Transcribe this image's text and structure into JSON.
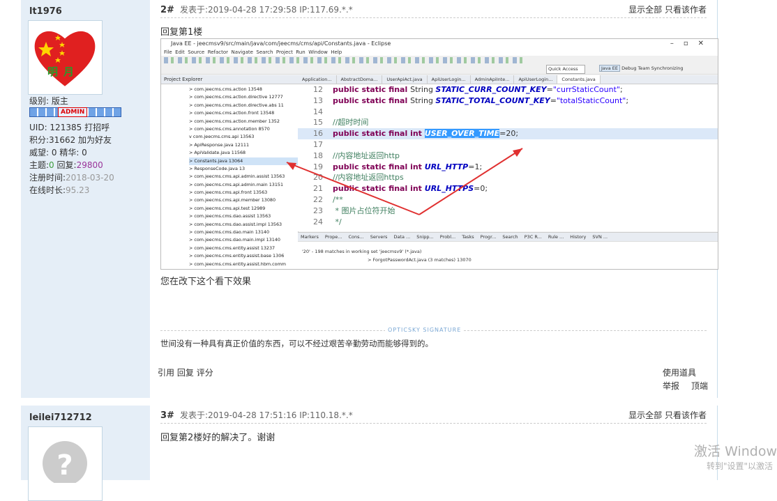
{
  "post1": {
    "username": "lt1976",
    "avatar_text": "明月",
    "level": "级别: 版主",
    "admin_badge": "ADMIN",
    "uid": "UID: 121385",
    "greet": "打招呼",
    "points": "积分:31662",
    "add_friend": "加为好友",
    "prestige": "威望: 0",
    "essence": "精华: 0",
    "topics_label": "主题:",
    "topics": "0",
    "replies_label": "回复:",
    "replies": "29800",
    "reg_label": "注册时间:",
    "reg_date": "2018-03-20",
    "online_label": "在线时长:",
    "online": "95.23",
    "floor": "2#",
    "time": "发表于:2019-04-28 17:29:58  IP:117.69.*.*",
    "show_all": "显示全部",
    "only_author": "只看该作者",
    "reply_to": "回复第1楼",
    "body": "您在改下这个看下效果",
    "sig_label": "OPTICSKY SIGNATURE",
    "signature": "世间没有一种具有真正价值的东西，可以不经过艰苦辛勤劳动而能够得到的。",
    "actions": [
      "引用",
      "回复",
      "评分"
    ],
    "use_tool": "使用道具",
    "report": "举报",
    "top": "顶端"
  },
  "post2": {
    "username": "leilei712712",
    "floor": "3#",
    "time": "发表于:2019-04-28 17:51:16  IP:110.18.*.*",
    "show_all": "显示全部",
    "only_author": "只看该作者",
    "body": "回复第2楼好的解决了。谢谢"
  },
  "eclipse": {
    "title": "Java EE - jeecmsv9/src/main/java/com/jeecms/cms/api/Constants.java - Eclipse",
    "menu": [
      "File",
      "Edit",
      "Source",
      "Refactor",
      "Navigate",
      "Search",
      "Project",
      "Run",
      "Window",
      "Help"
    ],
    "quick_access": "Quick Access",
    "perspectives": [
      "Java EE",
      "Debug",
      "Team Synchronizing"
    ],
    "explorer_tab": "Project Explorer",
    "tree": [
      "> com.jeecms.cms.action 13548",
      "> com.jeecms.cms.action.directive 12777",
      "> com.jeecms.cms.action.directive.abs 11",
      "> com.jeecms.cms.action.front 13548",
      "> com.jeecms.cms.action.member 1352",
      "> com.jeecms.cms.annotation 8570",
      "v com.jeecms.cms.api 13563",
      "  > ApiResponse.java 12111",
      "  > ApiValidate.java 11568",
      "  > Constants.java 13064",
      "  > ResponseCode.java 13",
      "> com.jeecms.cms.api.admin.assist 13563",
      "> com.jeecms.cms.api.admin.main 13151",
      "> com.jeecms.cms.api.front 13563",
      "> com.jeecms.cms.api.member 13080",
      "> com.jeecms.cms.api.test 12989",
      "> com.jeecms.cms.dao.assist 13563",
      "> com.jeecms.cms.dao.assist.impl 13563",
      "> com.jeecms.cms.dao.main 13140",
      "> com.jeecms.cms.dao.main.impl 13140",
      "> com.jeecms.cms.entity.assist 13237",
      "> com.jeecms.cms.entity.assist.base 1306",
      "> com.jeecms.cms.entity.assist.hbm.comm"
    ],
    "editor_tabs": [
      "Application...",
      "AbstractDoma...",
      "UserApiAct.java",
      "ApiUserLogin...",
      "AdminApiInte...",
      "ApiUserLogin...",
      "Constants.java"
    ],
    "code": [
      {
        "n": "12",
        "kind": "field",
        "pre": "public static final ",
        "type": "String ",
        "name": "STATIC_CURR_COUNT_KEY",
        "rest": "=",
        "str": "\"currStaticCount\"",
        "end": ";"
      },
      {
        "n": "13",
        "kind": "field",
        "pre": "public static final ",
        "type": "String ",
        "name": "STATIC_TOTAL_COUNT_KEY",
        "rest": "=",
        "str": "\"totalStaticCount\"",
        "end": ";"
      },
      {
        "n": "14",
        "kind": "blank"
      },
      {
        "n": "15",
        "kind": "comment",
        "text": "//超时时间"
      },
      {
        "n": "16",
        "kind": "selected",
        "pre": "public static final int ",
        "name": "USER_OVER_TIME",
        "rest": "=20;"
      },
      {
        "n": "17",
        "kind": "blank"
      },
      {
        "n": "18",
        "kind": "comment",
        "text": "//内容地址返回http"
      },
      {
        "n": "19",
        "kind": "intfield",
        "pre": "public static final int ",
        "name": "URL_HTTP",
        "rest": "=1;"
      },
      {
        "n": "20",
        "kind": "comment",
        "text": "//内容地址返回https"
      },
      {
        "n": "21",
        "kind": "intfield",
        "pre": "public static final int ",
        "name": "URL_HTTPS",
        "rest": "=0;"
      },
      {
        "n": "22",
        "kind": "comment",
        "text": "/**"
      },
      {
        "n": "23",
        "kind": "comment",
        "text": " * 图片占位符开始"
      },
      {
        "n": "24",
        "kind": "comment",
        "text": " */"
      }
    ],
    "bottom_tabs": [
      "Markers",
      "Prope...",
      "Cons...",
      "Servers",
      "Data ...",
      "Snipp...",
      "Probl...",
      "Tasks",
      "Progr...",
      "Search",
      "P3C R...",
      "Rule ...",
      "History",
      "SVN ..."
    ],
    "search_result": "'20' - 198 matches in working set 'jeecmsv9' (*.java)",
    "search_item": "> ForgotPasswordAct.java (3 matches) 13070"
  },
  "watermark": {
    "line1": "激活 Window",
    "line2": "转到\"设置\"以激活"
  },
  "colors": {
    "sidebar": "#e5eef7",
    "accent_green": "#3a9a3a",
    "accent_purple": "#993399",
    "arrow": "#e03030"
  }
}
